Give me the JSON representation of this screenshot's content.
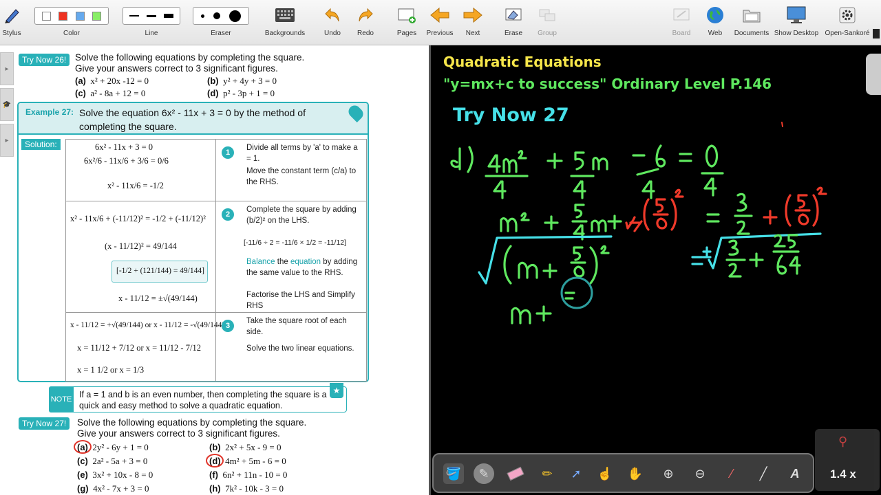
{
  "toolbar": {
    "stylus": "Stylus",
    "color": "Color",
    "line": "Line",
    "eraser": "Eraser",
    "backgrounds": "Backgrounds",
    "undo": "Undo",
    "redo": "Redo",
    "pages": "Pages",
    "previous": "Previous",
    "next": "Next",
    "erase": "Erase",
    "group": "Group",
    "board": "Board",
    "web": "Web",
    "documents": "Documents",
    "show_desktop": "Show Desktop",
    "open_sankore": "Open-Sankoré",
    "colors": [
      "#ffffff",
      "#ee3322",
      "#66aaee",
      "#88ee66"
    ]
  },
  "book": {
    "try26": {
      "tag": "Try Now 26!",
      "line1": "Solve the following equations by completing the square.",
      "line2": "Give your answers correct to 3 significant figures.",
      "a": "x² + 20x -12 = 0",
      "b": "y² + 4y + 3 = 0",
      "c": "a² - 8a + 12 = 0",
      "d": "p² - 3p + 1 = 0"
    },
    "example": {
      "tag": "Example 27:",
      "title": "Solve the equation  6x² - 11x + 3 = 0 by the method of completing the square.",
      "solution_tag": "Solution:",
      "r1m1": "6x² - 11x + 3 = 0",
      "r1m2": "6x²/6 - 11x/6 + 3/6 = 0/6",
      "r1m3": "x² - 11x/6 = -1/2",
      "r1n1": "Divide all terms by 'a' to make a = 1.",
      "r1n2": "Move the constant term (c/a) to the RHS.",
      "r2m1": "x² - 11x/6 + (-11/12)² = -1/2 + (-11/12)²",
      "r2m2": "(x - 11/12)² = 49/144",
      "r2m3": "[-1/2 + (121/144) = 49/144]",
      "r2m4": "x - 11/12 = ±√(49/144)",
      "r2n1": "Complete the square by adding (b/2)² on the LHS.",
      "r2n2": "[-11/6 ÷ 2 = -11/6 × 1/2 = -11/12]",
      "r2n3a": "Balance",
      "r2n3b": " the ",
      "r2n3c": "equation",
      "r2n3d": " by adding the same value to the RHS.",
      "r2n4": "Factorise the LHS and Simplify RHS",
      "r3m1": "x - 11/12 = +√(49/144)  or  x - 11/12 = -√(49/144)",
      "r3m2": "x = 11/12 + 7/12    or    x = 11/12 - 7/12",
      "r3m3": "x = 1 1/2          or          x = 1/3",
      "r3n1": "Take the square root of each side.",
      "r3n2": "Solve the two linear equations.",
      "step1": "1",
      "step2": "2",
      "step3": "3"
    },
    "note": {
      "tag": "NOTE",
      "text": "If a = 1 and b is an even number, then completing the square is a quick and easy method to solve a quadratic equation."
    },
    "try27": {
      "tag": "Try Now 27!",
      "line1": "Solve the following equations by completing the square.",
      "line2": "Give your answers correct to 3 significant figures.",
      "a": "2y² - 6y + 1 = 0",
      "b": "2x² + 5x - 9 = 0",
      "c": "2a² - 5a + 3 = 0",
      "d": "4m² + 5m - 6 = 0",
      "e": "3x² + 10x - 8 = 0",
      "f": "6n² + 11n - 10 = 0",
      "g": "4x² - 7x + 3 = 0",
      "h": "7k² - 10k - 3 = 0"
    },
    "labels": {
      "a": "(a)",
      "b": "(b)",
      "c": "(c)",
      "d": "(d)",
      "e": "(e)",
      "f": "(f)",
      "g": "(g)",
      "h": "(h)"
    }
  },
  "board": {
    "title": "Quadratic Equations",
    "subtitle": "\"y=mx+c to success\"  Ordinary Level P.146",
    "heading": "Try Now 27",
    "zoom": "1.4 x",
    "ink_colors": {
      "green": "#5fe85f",
      "red": "#f03a2a",
      "cyan": "#46e0e8",
      "yellow": "#f6e64a"
    }
  }
}
